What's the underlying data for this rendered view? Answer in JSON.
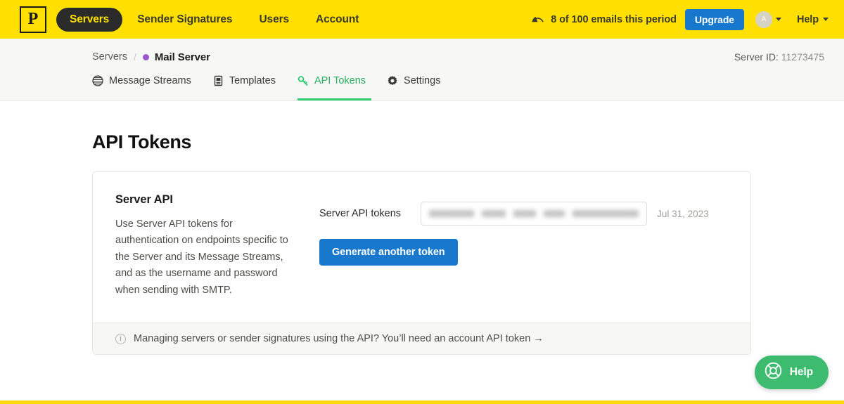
{
  "topnav": {
    "logo_letter": "P",
    "logo_name": "postmark-stamp-logo",
    "items": [
      {
        "label": "Servers",
        "active": true
      },
      {
        "label": "Sender Signatures",
        "active": false
      },
      {
        "label": "Users",
        "active": false
      },
      {
        "label": "Account",
        "active": false
      }
    ],
    "quota_text": "8 of 100 emails this period",
    "quota_icon": "gauge-icon",
    "upgrade_label": "Upgrade",
    "avatar_initial": "A",
    "help_label": "Help",
    "brand_yellow": "#FFE000",
    "upgrade_blue": "#1878CE"
  },
  "subheader": {
    "breadcrumb": {
      "parent": "Servers",
      "separator": "/",
      "current": "Mail Server",
      "dot_color": "#9B59D0"
    },
    "server_id_label": "Server ID:",
    "server_id_value": "11273475",
    "tabs": [
      {
        "label": "Message Streams",
        "icon": "streams-icon",
        "active": false
      },
      {
        "label": "Templates",
        "icon": "template-icon",
        "active": false
      },
      {
        "label": "API Tokens",
        "icon": "key-icon",
        "active": true
      },
      {
        "label": "Settings",
        "icon": "gear-icon",
        "active": false
      }
    ],
    "active_color": "#27AE60"
  },
  "main": {
    "page_title": "API Tokens",
    "card": {
      "heading": "Server API",
      "description": "Use Server API tokens for authentication on endpoints specific to the Server and its Message Streams, and as the username and password when sending with SMTP.",
      "field_label": "Server API tokens",
      "token_value": "",
      "token_masked": true,
      "token_date": "Jul 31, 2023",
      "generate_label": "Generate another token",
      "footer_text": "Managing servers or sender signatures using the API? You’ll need an account API token →",
      "footer_icon": "info-icon"
    }
  },
  "help_widget": {
    "label": "Help",
    "icon": "life-ring-icon",
    "color": "#3DBB6E"
  }
}
